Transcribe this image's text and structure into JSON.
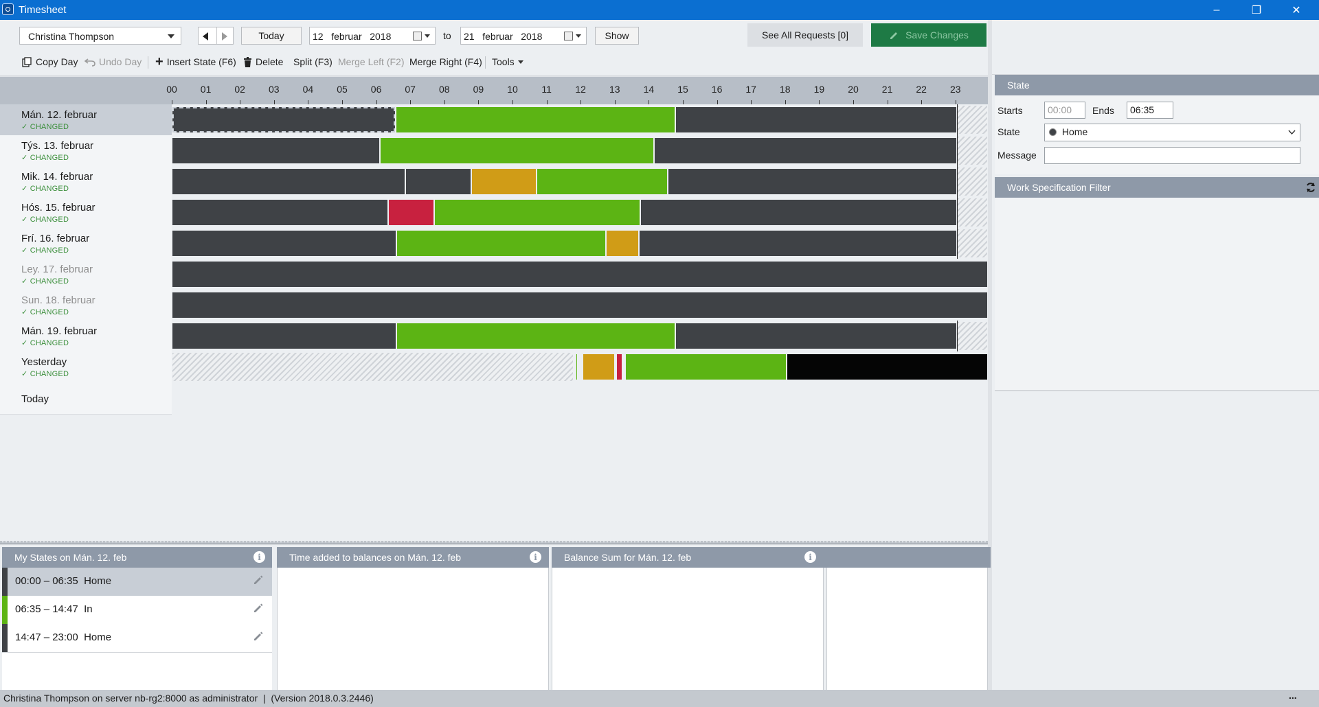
{
  "window": {
    "title": "Timesheet",
    "minimize": "–",
    "maximize": "❐",
    "close": "✕"
  },
  "toolbar": {
    "user": "Christina Thompson",
    "today": "Today",
    "from_date": "12   februar   2018",
    "to_label": "to",
    "to_date": "21   februar   2018",
    "show": "Show",
    "see_all_requests": "See All Requests [0]",
    "save_changes": "Save Changes"
  },
  "toolbar2": {
    "copy_day": "Copy Day",
    "undo_day": "Undo Day",
    "insert_state": "Insert State (F6)",
    "delete": "Delete",
    "split": "Split (F3)",
    "merge_left": "Merge Left (F2)",
    "merge_right": "Merge Right (F4)",
    "tools": "Tools"
  },
  "colors": {
    "home": "#3f4246",
    "in": "#5cb414",
    "orange": "#d09c17",
    "red": "#c8213f",
    "black": "#050505",
    "hatch": "#cfd3d8",
    "save_btn": "#1e7a45"
  },
  "hours": [
    "00",
    "01",
    "02",
    "03",
    "04",
    "05",
    "06",
    "07",
    "08",
    "09",
    "10",
    "11",
    "12",
    "13",
    "14",
    "15",
    "16",
    "17",
    "18",
    "19",
    "20",
    "21",
    "22",
    "23"
  ],
  "days": [
    {
      "name": "Mán. 12. februar",
      "status": "CHANGED",
      "selected": true,
      "weekend": false,
      "segments": [
        {
          "start": 0,
          "end": 6.58,
          "color": "home",
          "selected": true
        },
        {
          "start": 6.58,
          "end": 14.78,
          "color": "in"
        },
        {
          "start": 14.78,
          "end": 23.05,
          "color": "home"
        },
        {
          "start": 23.05,
          "end": 24,
          "color": "hatch"
        }
      ]
    },
    {
      "name": "Týs. 13. februar",
      "status": "CHANGED",
      "weekend": false,
      "segments": [
        {
          "start": 0,
          "end": 6.1,
          "color": "home"
        },
        {
          "start": 6.1,
          "end": 14.15,
          "color": "in"
        },
        {
          "start": 14.15,
          "end": 23.05,
          "color": "home"
        },
        {
          "start": 23.05,
          "end": 24,
          "color": "hatch"
        }
      ]
    },
    {
      "name": "Mik. 14. februar",
      "status": "CHANGED",
      "weekend": false,
      "segments": [
        {
          "start": 0,
          "end": 6.85,
          "color": "home"
        },
        {
          "start": 6.85,
          "end": 8.8,
          "color": "home"
        },
        {
          "start": 8.8,
          "end": 10.7,
          "color": "orange"
        },
        {
          "start": 10.7,
          "end": 14.55,
          "color": "in"
        },
        {
          "start": 14.55,
          "end": 23.05,
          "color": "home"
        },
        {
          "start": 23.05,
          "end": 24,
          "color": "hatch"
        }
      ]
    },
    {
      "name": "Hós. 15. februar",
      "status": "CHANGED",
      "weekend": false,
      "segments": [
        {
          "start": 0,
          "end": 6.35,
          "color": "home"
        },
        {
          "start": 6.35,
          "end": 7.7,
          "color": "red"
        },
        {
          "start": 7.7,
          "end": 13.75,
          "color": "in"
        },
        {
          "start": 13.75,
          "end": 23.05,
          "color": "home"
        },
        {
          "start": 23.05,
          "end": 24,
          "color": "hatch"
        }
      ]
    },
    {
      "name": "Frí. 16. februar",
      "status": "CHANGED",
      "weekend": false,
      "segments": [
        {
          "start": 0,
          "end": 6.6,
          "color": "home"
        },
        {
          "start": 6.6,
          "end": 12.75,
          "color": "in"
        },
        {
          "start": 12.75,
          "end": 13.7,
          "color": "orange"
        },
        {
          "start": 13.7,
          "end": 23.05,
          "color": "home"
        },
        {
          "start": 23.05,
          "end": 24,
          "color": "hatch"
        }
      ]
    },
    {
      "name": "Ley. 17. februar",
      "status": "CHANGED",
      "weekend": true,
      "segments": [
        {
          "start": 0,
          "end": 24,
          "color": "home"
        }
      ]
    },
    {
      "name": "Sun. 18. februar",
      "status": "CHANGED",
      "weekend": true,
      "segments": [
        {
          "start": 0,
          "end": 24,
          "color": "home"
        }
      ]
    },
    {
      "name": "Mán. 19. februar",
      "status": "CHANGED",
      "weekend": false,
      "segments": [
        {
          "start": 0,
          "end": 6.6,
          "color": "home"
        },
        {
          "start": 6.6,
          "end": 14.78,
          "color": "in"
        },
        {
          "start": 14.78,
          "end": 23.05,
          "color": "home"
        },
        {
          "start": 23.05,
          "end": 24,
          "color": "hatch"
        }
      ]
    },
    {
      "name": "Yesterday",
      "status": "CHANGED",
      "weekend": false,
      "segments": [
        {
          "start": 0,
          "end": 11.8,
          "color": "hatch"
        },
        {
          "start": 11.85,
          "end": 11.92,
          "color": "in"
        },
        {
          "start": 12.05,
          "end": 13.0,
          "color": "orange"
        },
        {
          "start": 13.05,
          "end": 13.22,
          "color": "red"
        },
        {
          "start": 13.3,
          "end": 18.05,
          "color": "in"
        },
        {
          "start": 18.05,
          "end": 24,
          "color": "black"
        }
      ]
    },
    {
      "name": "Today",
      "status": "",
      "weekend": false,
      "segments": []
    }
  ],
  "state_panel": {
    "header": "State",
    "starts_label": "Starts",
    "starts_value": "00:00",
    "ends_label": "Ends",
    "ends_value": "06:35",
    "state_label": "State",
    "state_value": "Home",
    "message_label": "Message",
    "message_value": ""
  },
  "work_spec": {
    "header": "Work Specification Filter"
  },
  "bottom": {
    "my_states_header": "My States on Mán. 12. feb",
    "time_added_header": "Time added to balances on Mán. 12. feb",
    "balance_sum_header": "Balance Sum for Mán. 12. feb",
    "states": [
      {
        "text": "00:00 – 06:35  Home",
        "color": "home"
      },
      {
        "text": "06:35 – 14:47  In",
        "color": "in"
      },
      {
        "text": "14:47 – 23:00  Home",
        "color": "home"
      }
    ]
  },
  "statusbar": {
    "text": "Christina Thompson on server nb-rg2:8000 as administrator  |  (Version 2018.0.3.2446)",
    "dots": "..."
  }
}
